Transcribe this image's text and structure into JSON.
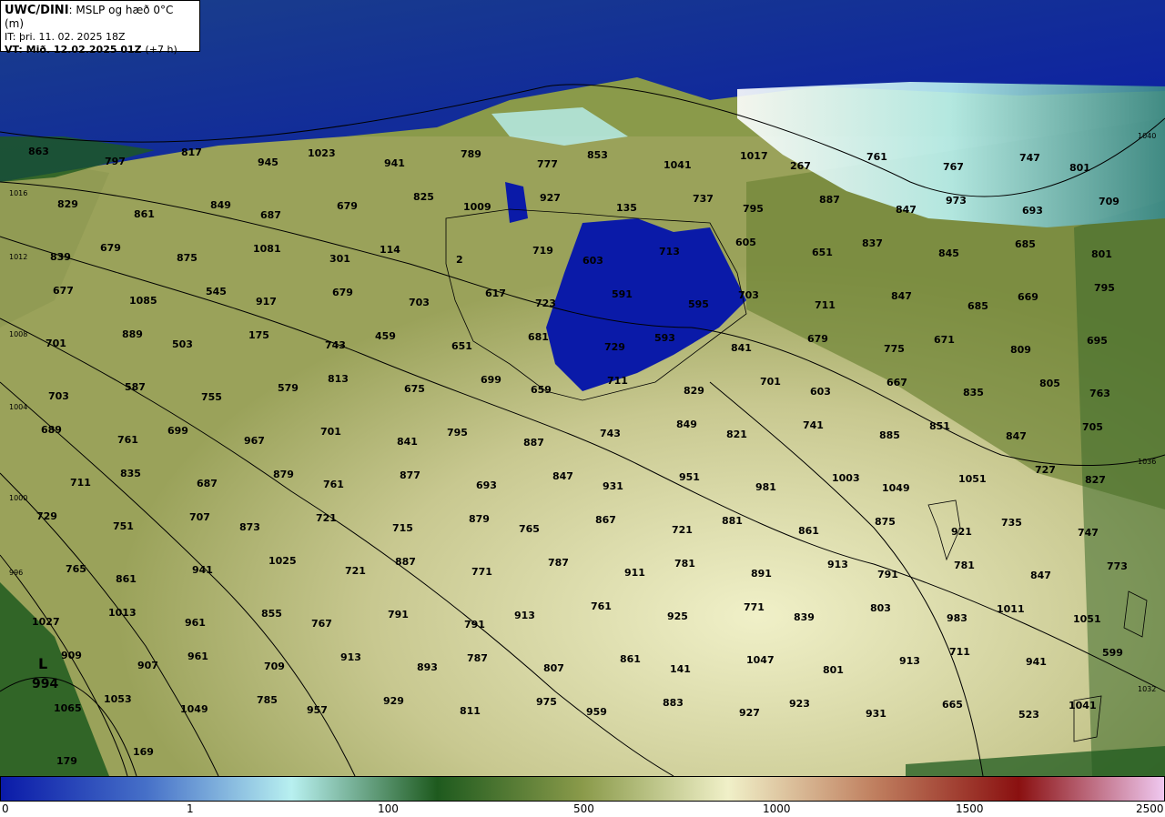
{
  "header": {
    "model": "UWC/DINI",
    "field": ": MSLP og hæð 0°C (m)",
    "it_line": "IT: þri. 11. 02. 2025 18Z",
    "vt_bold": "VT: Mið. 12.02.2025 01Z",
    "vt_offset": "(+7 h)"
  },
  "colorbar": {
    "colors": [
      "#0a1aa8",
      "#4670c8",
      "#b8f0f0",
      "#1e5a1e",
      "#8a9a4a",
      "#f0f0c8",
      "#c08060",
      "#8a1010",
      "#f0c8f0"
    ],
    "ticks": [
      "0",
      "1",
      "100",
      "500",
      "1000",
      "1500",
      "2500"
    ]
  },
  "low_center": {
    "symbol": "L",
    "value": "994"
  },
  "isobar_labels": [
    "1040",
    "1036",
    "1032",
    "1016",
    "1012",
    "1008",
    "1004",
    "1000",
    "996"
  ],
  "height_labels": [
    "863",
    "797",
    "817",
    "945",
    "1023",
    "941",
    "789",
    "777",
    "853",
    "1041",
    "1017",
    "267",
    "761",
    "767",
    "747",
    "801",
    "829",
    "861",
    "849",
    "687",
    "679",
    "825",
    "1009",
    "927",
    "135",
    "737",
    "795",
    "887",
    "847",
    "973",
    "693",
    "709",
    "839",
    "679",
    "875",
    "1081",
    "301",
    "114",
    "2",
    "719",
    "603",
    "713",
    "605",
    "651",
    "837",
    "845",
    "685",
    "801",
    "677",
    "1085",
    "545",
    "917",
    "679",
    "703",
    "617",
    "723",
    "591",
    "595",
    "703",
    "711",
    "847",
    "685",
    "669",
    "795",
    "701",
    "889",
    "503",
    "175",
    "743",
    "459",
    "651",
    "681",
    "729",
    "593",
    "841",
    "679",
    "775",
    "671",
    "809",
    "695",
    "703",
    "587",
    "755",
    "579",
    "813",
    "675",
    "699",
    "659",
    "711",
    "829",
    "701",
    "603",
    "667",
    "835",
    "805",
    "763",
    "689",
    "761",
    "699",
    "967",
    "701",
    "841",
    "795",
    "887",
    "743",
    "849",
    "821",
    "741",
    "885",
    "851",
    "847",
    "705",
    "711",
    "835",
    "687",
    "879",
    "761",
    "877",
    "693",
    "847",
    "931",
    "951",
    "981",
    "1003",
    "1049",
    "1051",
    "727",
    "827",
    "729",
    "751",
    "707",
    "873",
    "721",
    "715",
    "879",
    "765",
    "867",
    "721",
    "881",
    "861",
    "875",
    "921",
    "735",
    "747",
    "765",
    "861",
    "941",
    "1025",
    "721",
    "887",
    "771",
    "787",
    "911",
    "781",
    "891",
    "913",
    "791",
    "781",
    "847",
    "773",
    "1027",
    "1013",
    "961",
    "855",
    "767",
    "791",
    "791",
    "913",
    "761",
    "925",
    "771",
    "839",
    "803",
    "983",
    "1011",
    "1051",
    "909",
    "907",
    "961",
    "709",
    "913",
    "893",
    "787",
    "807",
    "861",
    "141",
    "1047",
    "801",
    "913",
    "711",
    "941",
    "599",
    "1065",
    "1053",
    "1049",
    "785",
    "957",
    "929",
    "811",
    "975",
    "959",
    "883",
    "927",
    "923",
    "931",
    "665",
    "523",
    "1041",
    "179",
    "169"
  ]
}
